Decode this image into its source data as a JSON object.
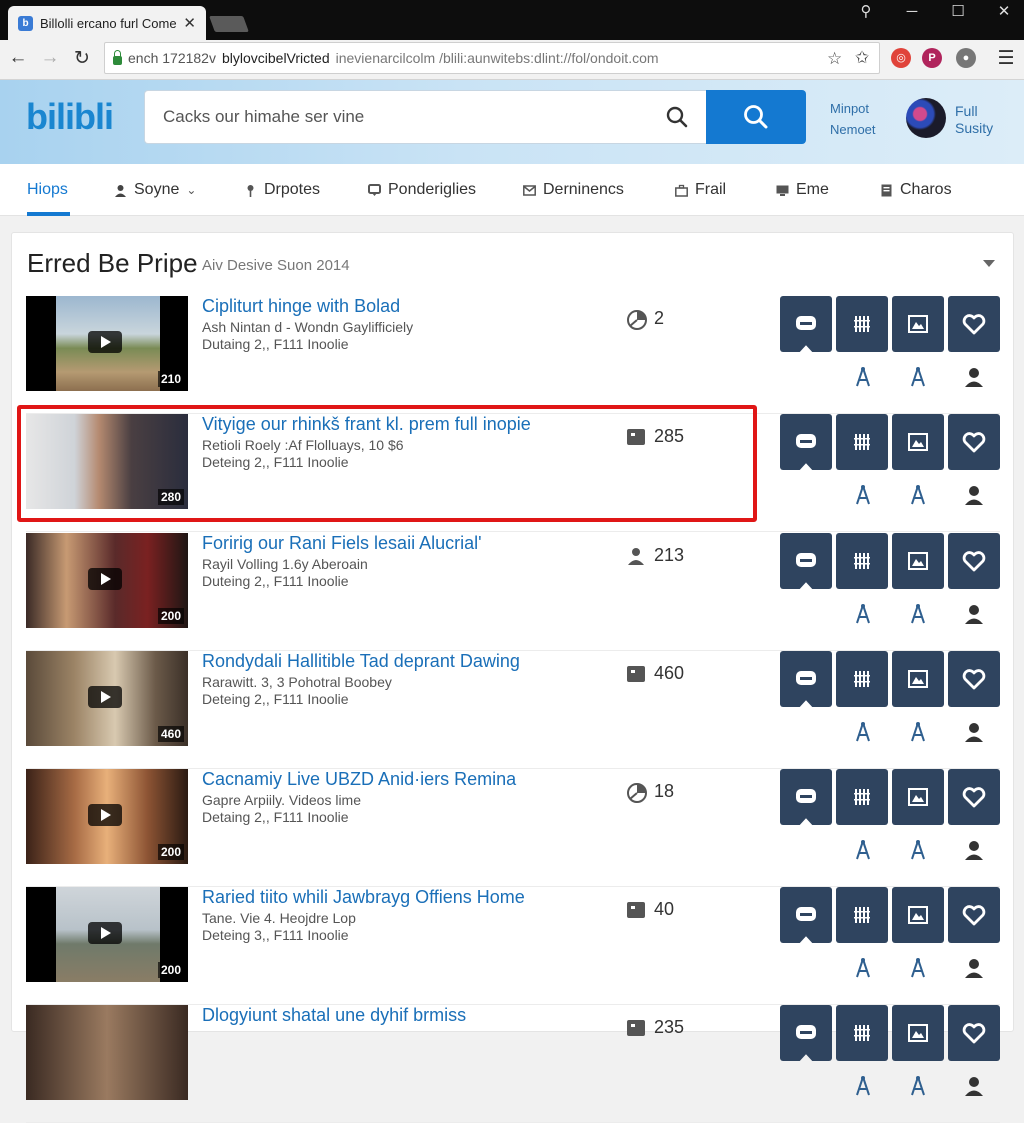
{
  "browser": {
    "tab_title": "Billolli ercano furl Comer",
    "tab_icon": "bilibili-favicon",
    "url_host": "ench 172182v",
    "url_main": "blylovcibelVricted",
    "url_rest": "inevienarcilcolm /blili:aunwitebs:dlint://fol/ondoit.com"
  },
  "site": {
    "logo": "bilibli",
    "search_placeholder": "Cacks our himahe ser vine",
    "header_link_1": "Minpot",
    "header_link_2": "Nemoet",
    "user_name_1": "Full",
    "user_name_2": "Susity",
    "accent": "#1479d1"
  },
  "nav": [
    {
      "label": "Hiops",
      "icon": "none",
      "active": true
    },
    {
      "label": "Soyne",
      "icon": "person-icon",
      "dropdown": true
    },
    {
      "label": "Drpotes",
      "icon": "pin-icon"
    },
    {
      "label": "Ponderiglies",
      "icon": "comment-icon"
    },
    {
      "label": "Derninencs",
      "icon": "mail-icon"
    },
    {
      "label": "Frail",
      "icon": "briefcase-icon"
    },
    {
      "label": "Eme",
      "icon": "monitor-icon"
    },
    {
      "label": "Charos",
      "icon": "document-icon"
    }
  ],
  "section": {
    "title": "Erred Be Pripe",
    "subtitle": "Aiv Desive Suon 2014"
  },
  "videos": [
    {
      "title": "Cipliturt hinge with Bolad",
      "meta1": "Ash Nintan d - Wondn Gaylifficiely",
      "meta2": "Dutaing 2,, F111 Inoolie",
      "count": "2",
      "stat_icon": "chart-icon",
      "duration": "210"
    },
    {
      "title": "Vityige our rhinkš frant kl. prem full inopie",
      "meta1": "Retioli Roely :Af Flolluays, 10 $6",
      "meta2": "Deteing 2,, F111 Inoolie",
      "count": "285",
      "stat_icon": "square-icon",
      "duration": "280"
    },
    {
      "title": "Foririg our Rani Fiels lesaii Alucrial'",
      "meta1": "Rayil Volling  1.6y Aberoain",
      "meta2": "Duteing 2,, F111 Inoolie",
      "count": "213",
      "stat_icon": "person-icon",
      "duration": "200"
    },
    {
      "title": "Rondydali Hallitible Tad deprant Dawing",
      "meta1": "Rarawitt. 3, 3 Pohotral Boobey",
      "meta2": "Deteing 2,, F111 Inoolie",
      "count": "460",
      "stat_icon": "square-icon",
      "duration": "460"
    },
    {
      "title": "Cacnamiy Live UBZD Anid·iers Remina",
      "meta1": "Gapre Arpiily. Videos lime",
      "meta2": "Detaing 2,, F111 Inoolie",
      "count": "18",
      "stat_icon": "chart-icon",
      "duration": "200"
    },
    {
      "title": "Raried tiito whili Jawbrayg Offiens Home",
      "meta1": "Tane. Vie 4. Heojdre Lop",
      "meta2": "Deteing 3,, F111 Inoolie",
      "count": "40",
      "stat_icon": "square-icon",
      "duration": "200"
    },
    {
      "title": "Dlogyiunt shatal une dyhif brmiss",
      "meta1": "",
      "meta2": "",
      "count": "235",
      "stat_icon": "square-icon",
      "duration": ""
    }
  ],
  "row_actions": [
    "chat-icon",
    "grid-icon",
    "image-icon",
    "heart-icon"
  ],
  "row_sub_actions": [
    "tower-icon",
    "tower-icon",
    "person-icon"
  ],
  "highlight_color": "#e01616"
}
